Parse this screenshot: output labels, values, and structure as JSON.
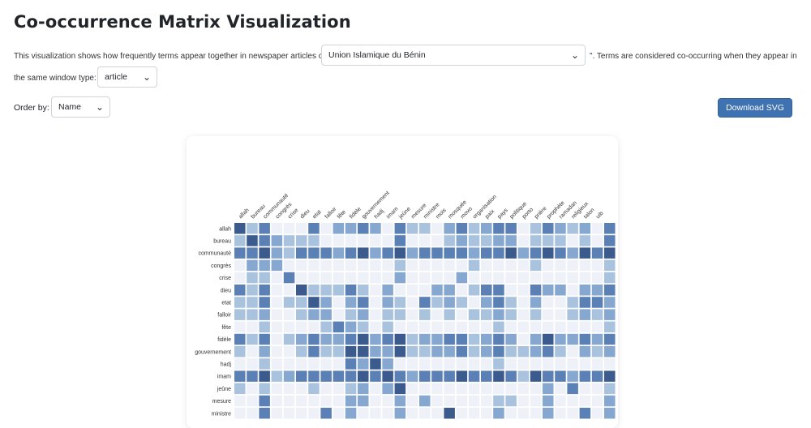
{
  "title": "Co-occurrence Matrix Visualization",
  "description": {
    "prefix": "This visualization shows how frequently terms appear together in newspaper articles on \"",
    "suffix": "\". Terms are considered co-occurring when they appear in",
    "line2": "the same window type:"
  },
  "topic_select": {
    "value": "Union Islamique du Bénin"
  },
  "window_select": {
    "value": "article"
  },
  "order": {
    "label": "Order by:",
    "value": "Name"
  },
  "download_label": "Download SVG",
  "icons": {
    "chevron": "chevron-down-icon"
  },
  "colors": {
    "accent": "#3f72b0",
    "cell_low": "#eef2f8",
    "cell_high": "#3b5a8e"
  },
  "chart_data": {
    "type": "heatmap",
    "columns": [
      "allah",
      "bureau",
      "communauté",
      "congrès",
      "crise",
      "dieu",
      "etat",
      "falloir",
      "fête",
      "fidèle",
      "gouvernement",
      "hadj",
      "imam",
      "jeûne",
      "mesure",
      "ministre",
      "mois",
      "mosquée",
      "movo",
      "organisation",
      "paix",
      "pays",
      "politique",
      "porto",
      "prière",
      "prophète",
      "ramadan",
      "religieux",
      "talon",
      "uib"
    ],
    "rows": [
      "allah",
      "bureau",
      "communauté",
      "congrès",
      "crise",
      "dieu",
      "etat",
      "falloir",
      "fête",
      "fidèle",
      "gouvernement",
      "hadj",
      "imam",
      "jeûne",
      "mesure",
      "ministre"
    ],
    "values": [
      [
        4,
        1,
        3,
        0,
        0,
        0,
        3,
        0,
        2,
        2,
        3,
        2,
        0,
        3,
        1,
        1,
        0,
        2,
        3,
        1,
        2,
        3,
        3,
        0,
        1,
        3,
        2,
        1,
        2,
        0,
        3
      ],
      [
        1,
        4,
        3,
        2,
        1,
        1,
        1,
        0,
        0,
        0,
        0,
        0,
        0,
        3,
        0,
        0,
        0,
        1,
        2,
        1,
        1,
        2,
        2,
        0,
        1,
        1,
        1,
        0,
        1,
        0,
        3
      ],
      [
        3,
        3,
        4,
        2,
        1,
        3,
        3,
        3,
        2,
        3,
        4,
        2,
        3,
        4,
        2,
        3,
        3,
        3,
        3,
        2,
        3,
        3,
        4,
        2,
        3,
        4,
        3,
        2,
        4,
        3,
        4
      ],
      [
        0,
        2,
        2,
        2,
        0,
        0,
        0,
        0,
        0,
        0,
        0,
        0,
        0,
        1,
        0,
        0,
        0,
        0,
        0,
        1,
        0,
        0,
        0,
        0,
        1,
        0,
        0,
        0,
        0,
        0,
        1
      ],
      [
        0,
        1,
        1,
        0,
        3,
        0,
        0,
        0,
        0,
        0,
        0,
        0,
        0,
        2,
        0,
        0,
        0,
        0,
        2,
        0,
        0,
        0,
        0,
        0,
        0,
        0,
        0,
        0,
        0,
        0,
        1
      ],
      [
        3,
        1,
        3,
        0,
        0,
        4,
        1,
        1,
        1,
        3,
        1,
        0,
        2,
        0,
        0,
        0,
        2,
        2,
        0,
        1,
        3,
        3,
        0,
        0,
        3,
        2,
        2,
        0,
        2,
        2,
        3
      ],
      [
        1,
        1,
        3,
        0,
        1,
        1,
        4,
        2,
        0,
        2,
        3,
        0,
        2,
        1,
        0,
        3,
        1,
        2,
        1,
        0,
        2,
        3,
        1,
        0,
        2,
        0,
        0,
        1,
        3,
        3,
        2
      ],
      [
        1,
        1,
        2,
        0,
        0,
        1,
        2,
        2,
        0,
        1,
        2,
        0,
        1,
        1,
        0,
        1,
        0,
        1,
        0,
        1,
        1,
        2,
        1,
        0,
        1,
        0,
        0,
        1,
        2,
        1,
        2
      ],
      [
        0,
        0,
        1,
        0,
        0,
        0,
        0,
        1,
        3,
        2,
        1,
        0,
        1,
        0,
        0,
        0,
        0,
        0,
        0,
        0,
        0,
        1,
        0,
        0,
        0,
        0,
        0,
        0,
        0,
        0,
        1
      ],
      [
        3,
        1,
        3,
        0,
        1,
        2,
        3,
        2,
        2,
        3,
        4,
        2,
        3,
        4,
        1,
        2,
        2,
        3,
        3,
        1,
        2,
        3,
        2,
        0,
        2,
        4,
        2,
        2,
        3,
        2,
        3
      ],
      [
        1,
        0,
        2,
        0,
        0,
        1,
        3,
        1,
        1,
        4,
        4,
        2,
        2,
        4,
        1,
        1,
        2,
        2,
        3,
        1,
        2,
        3,
        1,
        1,
        2,
        3,
        1,
        0,
        2,
        1,
        2
      ],
      [
        0,
        0,
        1,
        0,
        0,
        0,
        0,
        0,
        0,
        3,
        2,
        4,
        2,
        0,
        0,
        0,
        0,
        0,
        0,
        0,
        0,
        1,
        0,
        0,
        0,
        0,
        0,
        0,
        0,
        0,
        0
      ],
      [
        3,
        3,
        4,
        1,
        2,
        3,
        3,
        3,
        3,
        3,
        4,
        3,
        4,
        3,
        2,
        3,
        3,
        3,
        4,
        3,
        3,
        4,
        3,
        1,
        4,
        3,
        3,
        2,
        3,
        3,
        4
      ],
      [
        1,
        0,
        1,
        0,
        0,
        0,
        1,
        0,
        0,
        1,
        2,
        0,
        2,
        4,
        0,
        0,
        0,
        0,
        0,
        0,
        0,
        0,
        0,
        0,
        0,
        2,
        0,
        3,
        0,
        0,
        1
      ],
      [
        0,
        0,
        3,
        0,
        0,
        0,
        0,
        0,
        0,
        2,
        2,
        0,
        0,
        2,
        0,
        2,
        0,
        0,
        0,
        0,
        0,
        1,
        1,
        0,
        0,
        2,
        0,
        0,
        0,
        0,
        2
      ],
      [
        0,
        0,
        3,
        0,
        0,
        0,
        0,
        3,
        0,
        2,
        0,
        0,
        0,
        2,
        0,
        0,
        0,
        4,
        0,
        0,
        0,
        2,
        0,
        0,
        0,
        2,
        0,
        0,
        3,
        0,
        2
      ]
    ]
  }
}
